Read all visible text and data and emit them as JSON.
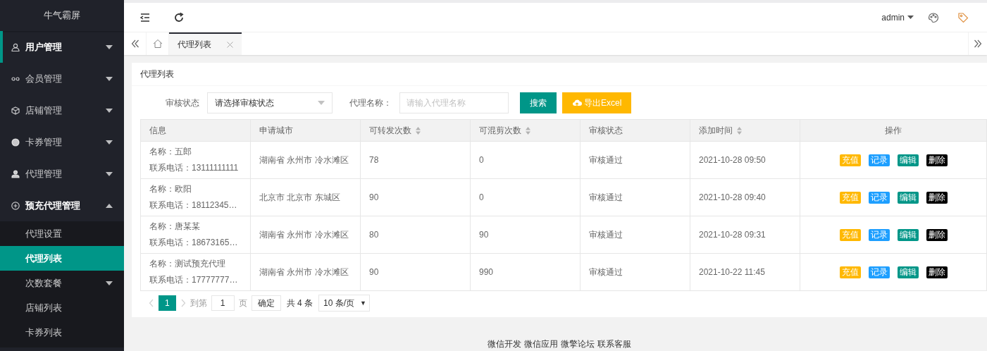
{
  "sidebar": {
    "logo": "牛气霸屏",
    "items": [
      {
        "label": "用户管理",
        "selected": true,
        "expanded": false
      },
      {
        "label": "会员管理",
        "selected": false,
        "expanded": false
      },
      {
        "label": "店铺管理",
        "selected": false,
        "expanded": false
      },
      {
        "label": "卡券管理",
        "selected": false,
        "expanded": false
      },
      {
        "label": "代理管理",
        "selected": false,
        "expanded": false
      },
      {
        "label": "预充代理管理",
        "selected": false,
        "expanded": true,
        "children": [
          {
            "label": "代理设置",
            "selected": false,
            "has_submenu": false
          },
          {
            "label": "代理列表",
            "selected": true,
            "has_submenu": false
          },
          {
            "label": "次数套餐",
            "selected": false,
            "has_submenu": true
          },
          {
            "label": "店铺列表",
            "selected": false,
            "has_submenu": false
          },
          {
            "label": "卡券列表",
            "selected": false,
            "has_submenu": false
          }
        ]
      }
    ]
  },
  "header": {
    "user": "admin"
  },
  "tabs": [
    {
      "label": "代理列表",
      "selected": true
    }
  ],
  "card": {
    "title": "代理列表",
    "filters": {
      "status_label": "审核状态",
      "status_select": "请选择审核状态",
      "name_label": "代理名称：",
      "name_placeholder": "请输入代理名称",
      "search_button": "搜索",
      "export_button": "导出Excel"
    },
    "table": {
      "columns": [
        {
          "label": "信息",
          "sortable": false
        },
        {
          "label": "申请城市",
          "sortable": false
        },
        {
          "label": "可转发次数",
          "sortable": true
        },
        {
          "label": "可混剪次数",
          "sortable": true
        },
        {
          "label": "审核状态",
          "sortable": false
        },
        {
          "label": "添加时间",
          "sortable": true
        },
        {
          "label": "操作",
          "sortable": false
        }
      ],
      "rows": [
        {
          "name": "名称：五郎",
          "phone": "联系电话：13111111111",
          "city": "湖南省 永州市 冷水滩区",
          "forward": "78",
          "remix": "0",
          "status": "审核通过",
          "time": "2021-10-28 09:50",
          "actions": [
            {
              "label": "充值",
              "color": "#ffb800"
            },
            {
              "label": "记录",
              "color": "#1e9fff"
            },
            {
              "label": "编辑",
              "color": "#009688"
            },
            {
              "label": "删除",
              "color": "#000000"
            }
          ]
        },
        {
          "name": "名称：欧阳",
          "phone": "联系电话：18112345…",
          "city": "北京市 北京市 东城区",
          "forward": "90",
          "remix": "0",
          "status": "审核通过",
          "time": "2021-10-28 09:40",
          "actions": [
            {
              "label": "充值",
              "color": "#ffb800"
            },
            {
              "label": "记录",
              "color": "#1e9fff"
            },
            {
              "label": "编辑",
              "color": "#009688"
            },
            {
              "label": "删除",
              "color": "#000000"
            }
          ]
        },
        {
          "name": "名称：唐某某",
          "phone": "联系电话：18673165…",
          "city": "湖南省 永州市 冷水滩区",
          "forward": "80",
          "remix": "90",
          "status": "审核通过",
          "time": "2021-10-28 09:31",
          "actions": [
            {
              "label": "充值",
              "color": "#ffb800"
            },
            {
              "label": "记录",
              "color": "#1e9fff"
            },
            {
              "label": "编辑",
              "color": "#009688"
            },
            {
              "label": "删除",
              "color": "#000000"
            }
          ]
        },
        {
          "name": "名称：测试预充代理",
          "phone": "联系电话：17777777…",
          "city": "湖南省 永州市 冷水滩区",
          "forward": "90",
          "remix": "990",
          "status": "审核通过",
          "time": "2021-10-22 11:45",
          "actions": [
            {
              "label": "充值",
              "color": "#ffb800"
            },
            {
              "label": "记录",
              "color": "#1e9fff"
            },
            {
              "label": "编辑",
              "color": "#009688"
            },
            {
              "label": "删除",
              "color": "#000000"
            }
          ]
        }
      ]
    },
    "pagination": {
      "pages": [
        {
          "label": "1",
          "selected": true
        }
      ],
      "goto_label": "到第",
      "goto_value": "1",
      "page_unit": "页",
      "confirm": "确定",
      "total": "共 4 条",
      "page_size": "10 条/页",
      "page_size_arrow": "▼"
    }
  },
  "footer": {
    "links": [
      "微信开发",
      "微信应用",
      "微擎论坛",
      "联系客服"
    ]
  }
}
